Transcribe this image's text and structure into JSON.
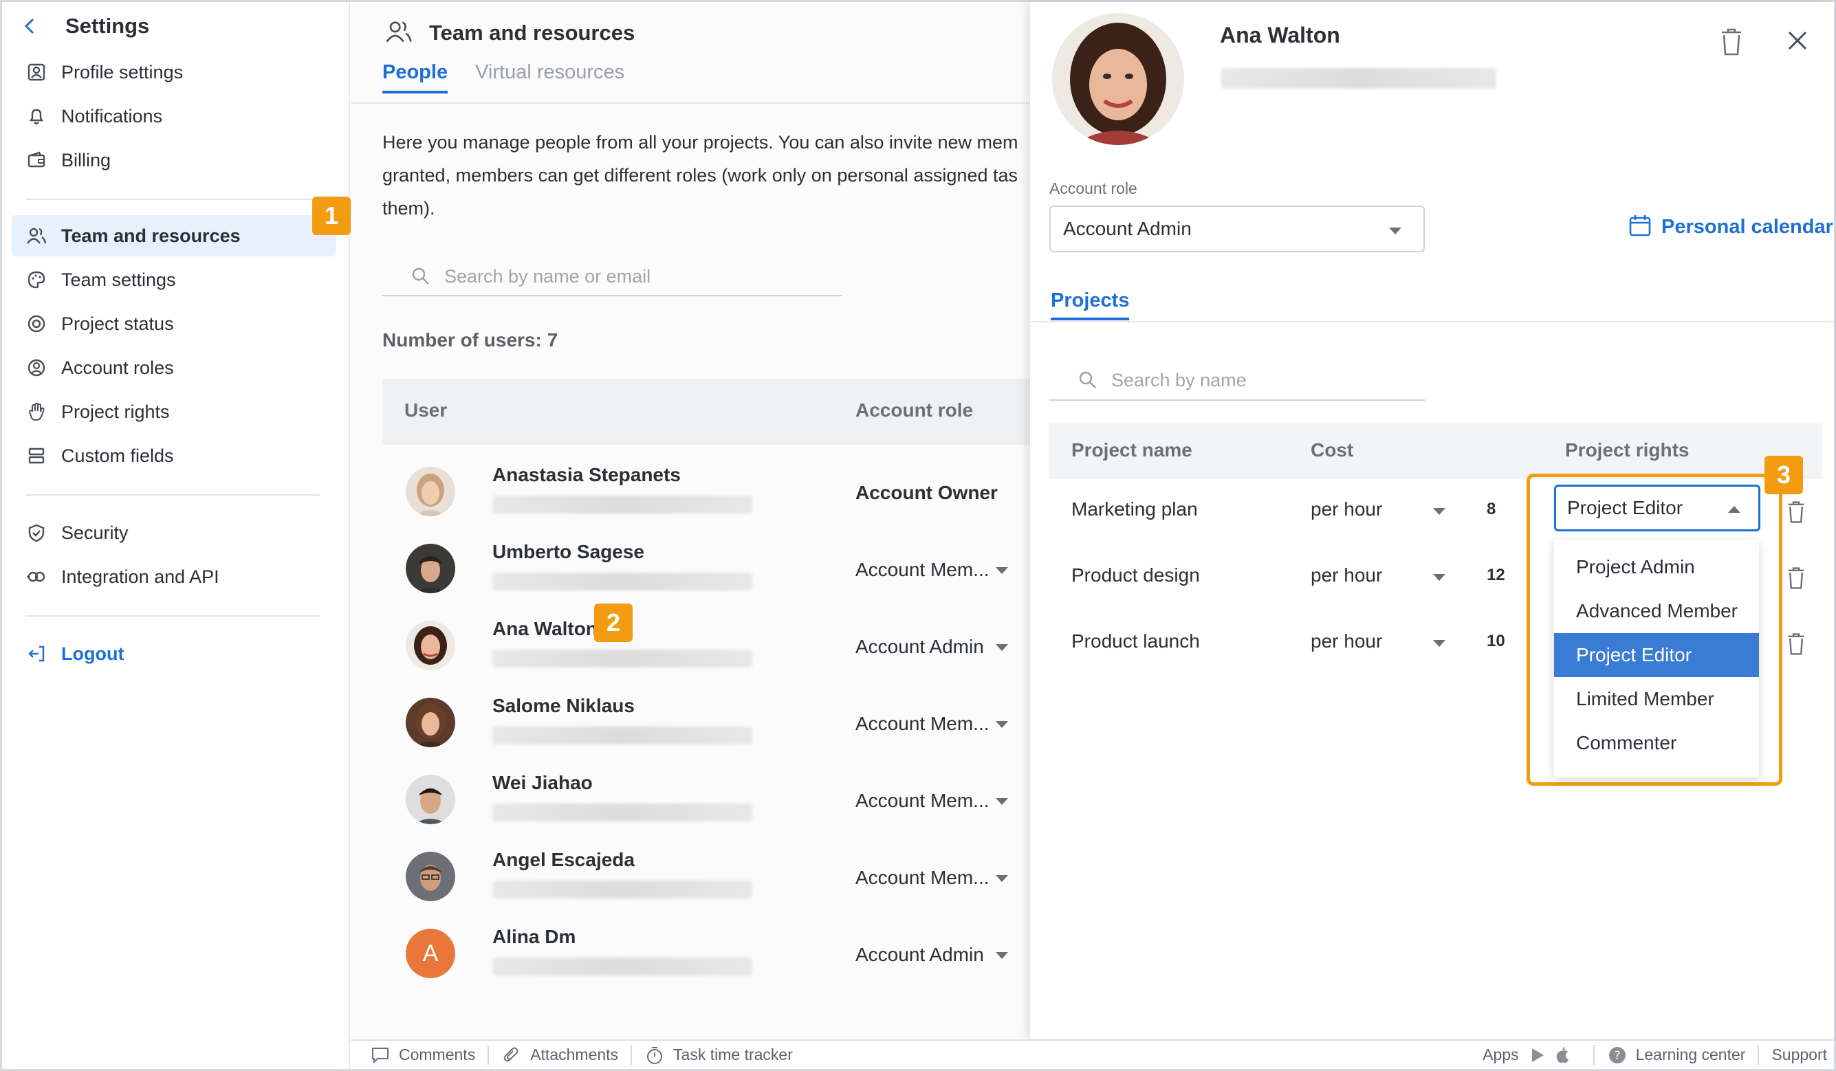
{
  "sidebar": {
    "title": "Settings",
    "items": [
      {
        "label": "Profile settings",
        "icon": "profile-icon"
      },
      {
        "label": "Notifications",
        "icon": "bell-icon"
      },
      {
        "label": "Billing",
        "icon": "wallet-icon"
      },
      {
        "label": "Team and resources",
        "icon": "team-icon",
        "active": true
      },
      {
        "label": "Team settings",
        "icon": "palette-icon"
      },
      {
        "label": "Project status",
        "icon": "status-icon"
      },
      {
        "label": "Account roles",
        "icon": "account-roles-icon"
      },
      {
        "label": "Project rights",
        "icon": "hand-icon"
      },
      {
        "label": "Custom fields",
        "icon": "fields-icon"
      },
      {
        "label": "Security",
        "icon": "shield-icon"
      },
      {
        "label": "Integration and API",
        "icon": "integration-icon"
      }
    ],
    "logout": "Logout"
  },
  "badges": {
    "one": "1",
    "two": "2",
    "three": "3"
  },
  "main": {
    "title": "Team and resources",
    "tabs": [
      "People",
      "Virtual resources"
    ],
    "description": [
      "Here you manage people from all your projects. You can also invite new mem",
      "granted, members can get different roles (work only on personal assigned tas",
      "them)."
    ],
    "search_placeholder": "Search by name or email",
    "user_count": "Number of users: 7",
    "columns": {
      "user": "User",
      "account_role": "Account role"
    },
    "users": [
      {
        "name": "Anastasia Stepanets",
        "role": "Account Owner"
      },
      {
        "name": "Umberto Sagese",
        "role": "Account Mem..."
      },
      {
        "name": "Ana Walton",
        "role": "Account Admin"
      },
      {
        "name": "Salome Niklaus",
        "role": "Account Mem..."
      },
      {
        "name": "Wei Jiahao",
        "role": "Account Mem..."
      },
      {
        "name": "Angel Escajeda",
        "role": "Account Mem..."
      },
      {
        "name": "Alina Dm",
        "role": "Account Admin",
        "initial": "A"
      }
    ]
  },
  "detail": {
    "name": "Ana Walton",
    "account_role_label": "Account role",
    "account_role_value": "Account Admin",
    "personal_calendar": "Personal calendar",
    "projects_tab": "Projects",
    "search_placeholder": "Search by name",
    "columns": {
      "project": "Project name",
      "cost": "Cost",
      "rights": "Project rights"
    },
    "projects": [
      {
        "name": "Marketing plan",
        "cost": "per hour",
        "value": "8"
      },
      {
        "name": "Product design",
        "cost": "per hour",
        "value": "12"
      },
      {
        "name": "Product launch",
        "cost": "per hour",
        "value": "10"
      }
    ],
    "rights_selected": "Project Editor",
    "rights_options": [
      "Project Admin",
      "Advanced Member",
      "Project Editor",
      "Limited Member",
      "Commenter"
    ]
  },
  "footer": {
    "comments": "Comments",
    "attachments": "Attachments",
    "tracker": "Task time tracker",
    "apps": "Apps",
    "learning": "Learning center",
    "support": "Support"
  },
  "colors": {
    "accent": "#1d6fd8",
    "highlight": "#f39c12",
    "selected": "#3a7bd5"
  }
}
